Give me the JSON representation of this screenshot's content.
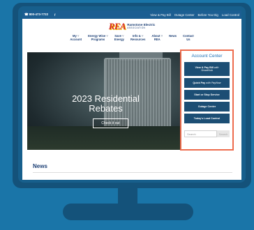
{
  "topbar": {
    "phone": "☎ 800-473-7722",
    "facebook": "f",
    "links": [
      "View & Pay Bill",
      "Outage Center",
      "Before You Dig",
      "Load Control"
    ]
  },
  "logo": {
    "mark": "REA",
    "line1": "Ramstone Electric",
    "line2": "ASSOCIATION"
  },
  "nav": [
    {
      "l1": "My",
      "l2": "Account",
      "caret": "˅"
    },
    {
      "l1": "Energy Wise",
      "l2": "Programs",
      "caret": "˅"
    },
    {
      "l1": "Save",
      "l2": "Energy",
      "caret": "˅"
    },
    {
      "l1": "Info &",
      "l2": "Resources",
      "caret": "˅"
    },
    {
      "l1": "About",
      "l2": "REA",
      "caret": "˅"
    },
    {
      "l1": "News",
      "l2": "",
      "caret": ""
    },
    {
      "l1": "Contact",
      "l2": "Us",
      "caret": ""
    }
  ],
  "hero": {
    "title_line1": "2023 Residential",
    "title_line2": "Rebates",
    "cta": "Check it out"
  },
  "account_center": {
    "title": "Account Center",
    "buttons": [
      {
        "label": "View & Pay Bill",
        "sub_inline": "with",
        "sub": "SmartHub"
      },
      {
        "label": "Quick Pay",
        "sub_inline": "with PayNow"
      },
      {
        "label": "Start or Stop Service"
      },
      {
        "label": "Outage Center"
      },
      {
        "label": "Today's Load Control"
      }
    ],
    "search_placeholder": "Search",
    "search_button": "Search"
  },
  "news": {
    "heading": "News"
  },
  "colors": {
    "background": "#1a75a8",
    "topbar": "#1c5e92",
    "navy": "#1c3f75",
    "button": "#1c4e74",
    "accent_border": "#ee6c4d",
    "account_title": "#1c6fb5"
  }
}
